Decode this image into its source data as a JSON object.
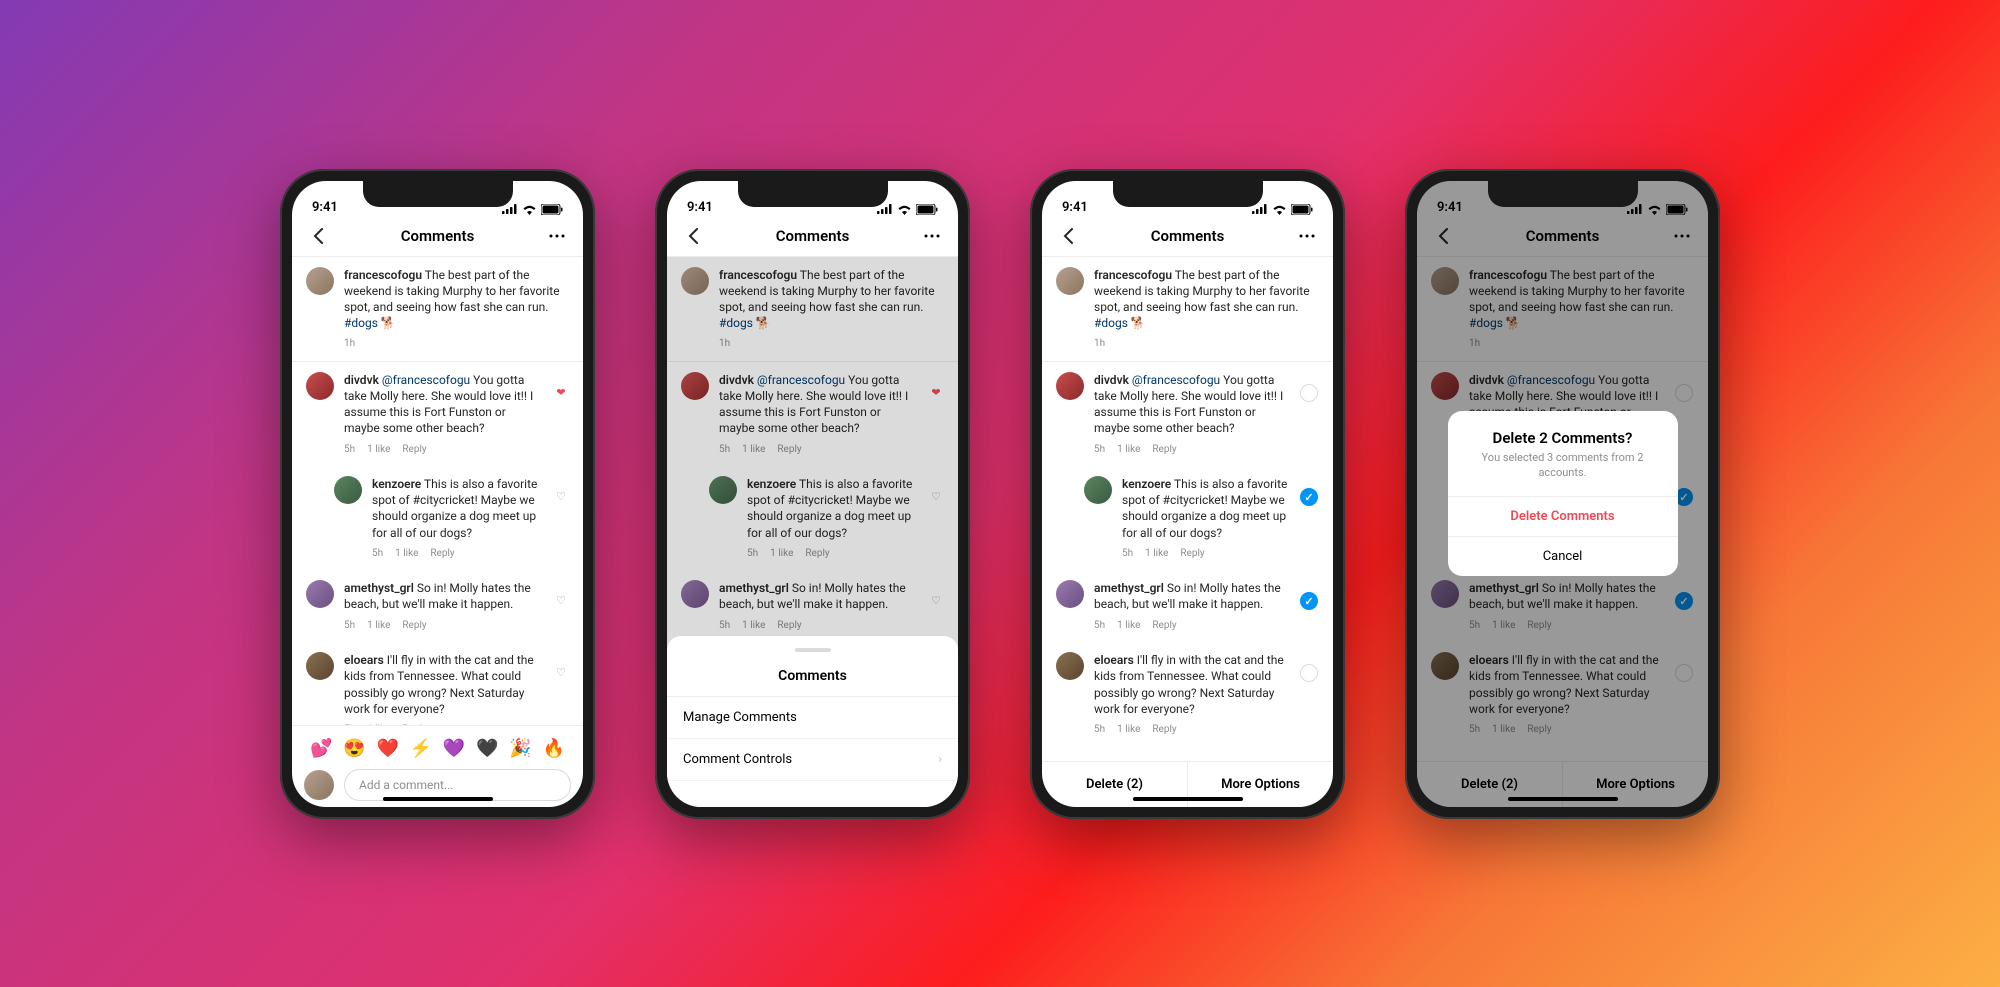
{
  "status": {
    "time": "9:41"
  },
  "nav": {
    "title": "Comments"
  },
  "caption": {
    "user": "francescofogu",
    "text": "The best part of the weekend is taking Murphy to her favorite spot, and seeing how fast she can run. ",
    "hashtag": "#dogs",
    "emoji": "🐕",
    "time": "1h"
  },
  "comments": [
    {
      "user": "divdvk",
      "mention": "@francescofogu",
      "text": " You gotta take Molly here. She would love it!! I assume this is Fort Funston or maybe some other beach?",
      "time": "5h",
      "likes": "1 like",
      "reply": "Reply",
      "liked": true,
      "isReply": false,
      "avatar": "red"
    },
    {
      "user": "kenzoere",
      "text": " This is also a favorite spot of #citycricket! Maybe we should organize a dog meet up for all of our dogs?",
      "time": "5h",
      "likes": "1 like",
      "reply": "Reply",
      "liked": false,
      "isReply": true,
      "avatar": "green"
    },
    {
      "user": "amethyst_grl",
      "text": " So in! Molly hates the beach, but we'll make it happen.",
      "time": "5h",
      "likes": "1 like",
      "reply": "Reply",
      "liked": false,
      "isReply": false,
      "avatar": "purple"
    },
    {
      "user": "eloears",
      "text": " I'll fly in with the cat and the kids from Tennessee. What could possibly go wrong? Next Saturday work for everyone?",
      "time": "5h",
      "likes": "1 like",
      "reply": "Reply",
      "liked": false,
      "isReply": false,
      "avatar": "brown"
    }
  ],
  "composer": {
    "placeholder": "Add a comment...",
    "emojis": [
      "💕",
      "😍",
      "❤️",
      "⚡",
      "💜",
      "🖤",
      "🎉",
      "🔥"
    ]
  },
  "sheet": {
    "title": "Comments",
    "items": [
      "Manage Comments",
      "Comment Controls"
    ]
  },
  "selection": {
    "selected": [
      false,
      true,
      true,
      false
    ],
    "delete_label": "Delete (2)",
    "more_label": "More Options"
  },
  "modal": {
    "title": "Delete 2 Comments?",
    "sub": "You selected 3 comments from 2 accounts.",
    "delete": "Delete Comments",
    "cancel": "Cancel"
  }
}
